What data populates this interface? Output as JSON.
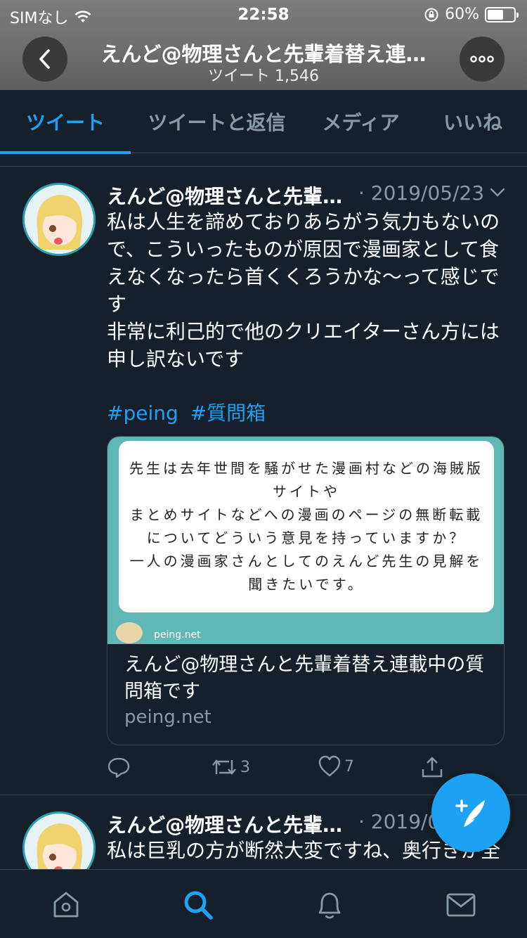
{
  "status_bar": {
    "carrier": "SIMなし",
    "time": "22:58",
    "battery": "60%",
    "battery_level": 0.6
  },
  "header": {
    "title": "えんど@物理さんと先輩着替え連…",
    "subtitle": "ツイート 1,546"
  },
  "tabs": [
    {
      "label": "ツイート",
      "active": true
    },
    {
      "label": "ツイートと返信",
      "active": false
    },
    {
      "label": "メディア",
      "active": false
    },
    {
      "label": "いいね",
      "active": false
    }
  ],
  "tweets": [
    {
      "name": "えんど@物理さんと先輩…",
      "date": "· 2019/05/23",
      "body_lines": [
        "私は人生を諦めておりあらがう気力もないの",
        "で、こういったものが原因で漫画家として食",
        "えなくなったら首くくろうかな〜って感じで",
        "す",
        "非常に利己的で他のクリエイターさん方には",
        "申し訳ないです"
      ],
      "hashtags": [
        "#peing",
        "#質問箱"
      ],
      "card": {
        "image_text": [
          "先生は去年世間を騒がせた漫画村などの海賊版",
          "サイトや",
          "まとめサイトなどへの漫画のページの無断転載",
          "についてどういう意見を持っていますか？",
          "一人の漫画家さんとしてのえんど先生の見解を",
          "聞きたいです。"
        ],
        "image_domain": "peing.net",
        "title": "えんど@物理さんと先輩着替え連載中の質問箱です",
        "url": "peing.net"
      },
      "actions": {
        "retweets": "3",
        "likes": "7"
      }
    },
    {
      "name": "えんど@物理さんと先輩…",
      "date": "· 2019/0",
      "body_lines": [
        "私は巨乳の方が断然大変ですね、奥行きが全"
      ]
    }
  ],
  "colors": {
    "accent": "#1da1f2",
    "background": "#15202b",
    "muted": "#8899a6",
    "border": "#38444d",
    "card_teal": "#5fb7b6"
  },
  "icons": {
    "header": [
      "back-chevron-icon",
      "more-dots-icon"
    ],
    "tweet_actions": [
      "reply-icon",
      "retweet-icon",
      "like-icon",
      "share-icon"
    ],
    "fab": "compose-tweet-icon",
    "bottom_nav": [
      "home-icon",
      "search-icon",
      "notifications-icon",
      "messages-icon"
    ]
  }
}
